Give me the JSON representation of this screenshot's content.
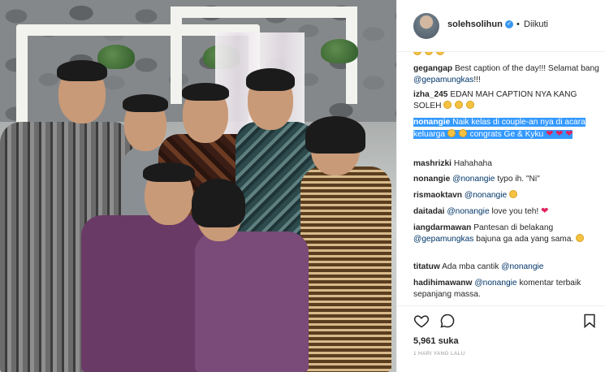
{
  "post": {
    "username": "solehsolihun",
    "follow_status": "Diikuti",
    "likes": "5,961 suka",
    "time_ago": "1 HARI YANG LALU"
  },
  "comments": [
    {
      "user": "gegangap",
      "text": "Best caption of the day!!! Selamat bang ",
      "mention": "@gepamungkas",
      "tail": "!!!"
    },
    {
      "user": "izha_245",
      "text": "EDAN MAH CAPTION NYA KANG SOLEH"
    },
    {
      "user": "nonangie",
      "text": "Naik kelas di couple-an nya di acara keluarga",
      "tail": "congrats Ge & Kyku"
    },
    {
      "user": "mashrizki",
      "text": "Hahahaha"
    },
    {
      "user": "nonangie",
      "mention": "@nonangie",
      "text": "typo ih. \"Ni\""
    },
    {
      "user": "rismaoktavn",
      "mention": "@nonangie"
    },
    {
      "user": "daitadai",
      "mention": "@nonangie",
      "text": "love you teh!"
    },
    {
      "user": "iangdarmawan",
      "text": "Pantesan di belakang",
      "mention": "@gepamungkas",
      "tail": "bajuna ga ada yang sama."
    },
    {
      "user": "titatuw",
      "text": "Ada mba cantik",
      "mention": "@nonangie"
    },
    {
      "user": "hadihimawanw",
      "mention": "@nonangie",
      "text": "komentar terbaik sepanjang massa."
    }
  ],
  "icons": {
    "like": "heart-outline-icon",
    "comment": "speech-bubble-icon",
    "save": "bookmark-icon",
    "verified": "verified-badge-icon"
  },
  "colors": {
    "mention": "#003569",
    "verified": "#3897f0",
    "selection": "#3399ff",
    "heart": "#e0245e"
  }
}
